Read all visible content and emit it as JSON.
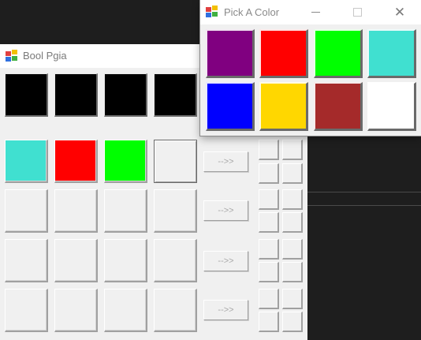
{
  "game_window": {
    "title": "Bool Pgia",
    "secret_row": [
      "#000000",
      "#000000",
      "#000000",
      "#000000"
    ],
    "guess_rows": [
      {
        "colors": [
          "#40e0d0",
          "#ff0000",
          "#00ff00",
          "#f0f0f0"
        ],
        "submit_label": "-->>"
      },
      {
        "colors": [
          "#f0f0f0",
          "#f0f0f0",
          "#f0f0f0",
          "#f0f0f0"
        ],
        "submit_label": "-->>"
      },
      {
        "colors": [
          "#f0f0f0",
          "#f0f0f0",
          "#f0f0f0",
          "#f0f0f0"
        ],
        "submit_label": "-->>"
      },
      {
        "colors": [
          "#f0f0f0",
          "#f0f0f0",
          "#f0f0f0",
          "#f0f0f0"
        ],
        "submit_label": "-->>"
      }
    ]
  },
  "picker_window": {
    "title": "Pick A Color",
    "controls": {
      "close_glyph": "✕"
    },
    "colors": [
      {
        "name": "purple",
        "hex": "#800080"
      },
      {
        "name": "red",
        "hex": "#ff0000"
      },
      {
        "name": "lime",
        "hex": "#00ff00"
      },
      {
        "name": "turquoise",
        "hex": "#40e0d0"
      },
      {
        "name": "blue",
        "hex": "#0000ff"
      },
      {
        "name": "gold",
        "hex": "#ffd700"
      },
      {
        "name": "brown",
        "hex": "#a52a2a"
      },
      {
        "name": "white",
        "hex": "#ffffff"
      }
    ]
  }
}
